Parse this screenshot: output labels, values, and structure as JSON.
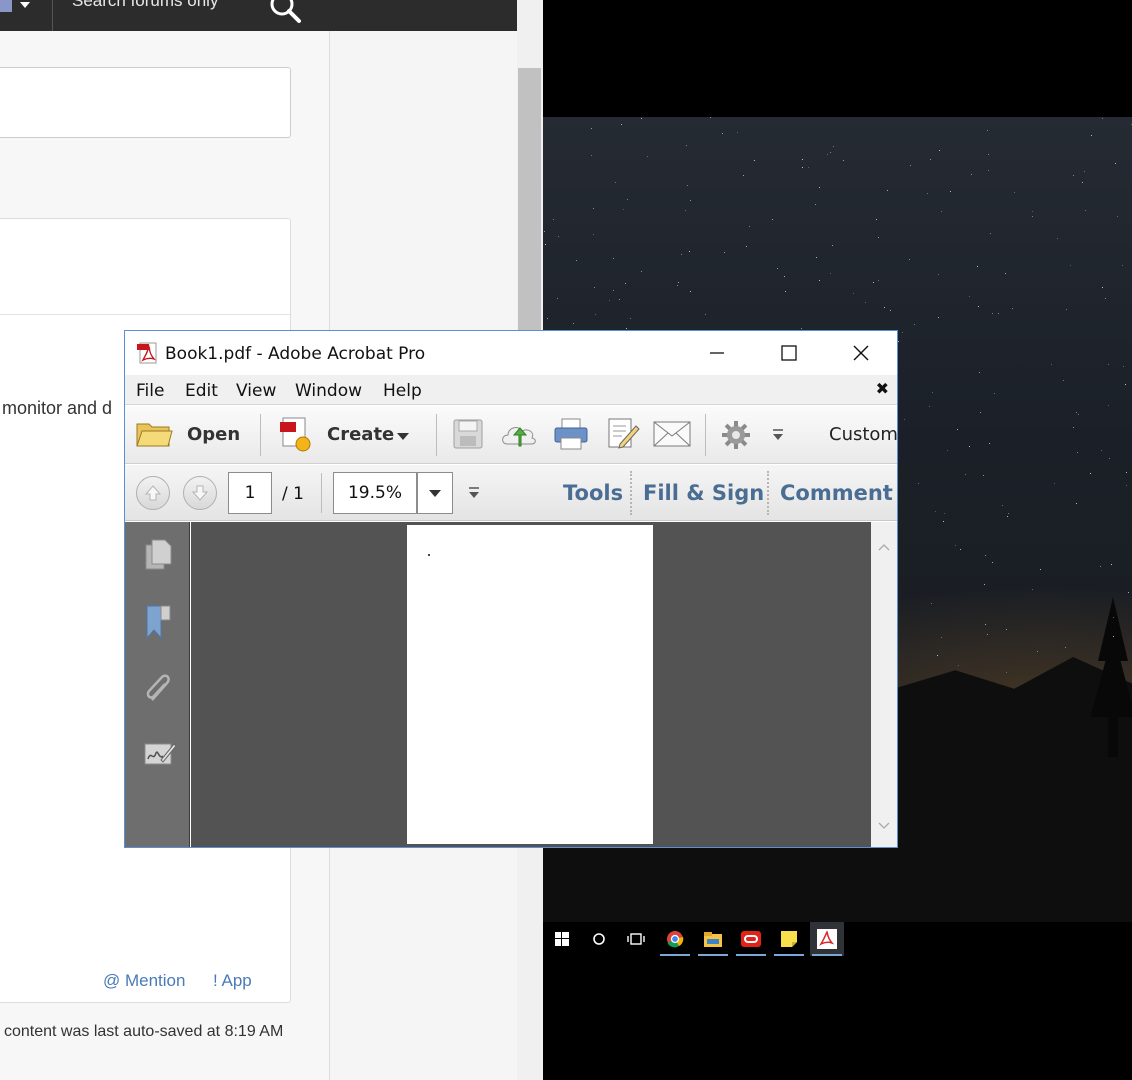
{
  "browser": {
    "search_placeholder": "Search forums only",
    "body_fragment": "monitor and d",
    "mention_label": "@ Mention",
    "app_label": "! App",
    "autosave_text": "content was last auto-saved at 8:19 AM"
  },
  "acrobat": {
    "title": "Book1.pdf - Adobe Acrobat Pro",
    "menu": [
      "File",
      "Edit",
      "View",
      "Window",
      "Help"
    ],
    "toolbar": {
      "open_label": "Open",
      "create_label": "Create",
      "customize_label": "Custom"
    },
    "nav": {
      "page_number": "1",
      "page_total": "/ 1",
      "zoom": "19.5%"
    },
    "panes": {
      "tools": "Tools",
      "fill_sign": "Fill & Sign",
      "comment": "Comment"
    }
  },
  "taskbar": {
    "icons": [
      "windows-start-icon",
      "cortana-search-icon",
      "task-view-icon",
      "chrome-icon",
      "file-explorer-icon",
      "oracle-icon",
      "sticky-notes-icon",
      "acrobat-icon"
    ]
  },
  "colors": {
    "acrobat_accent": "#4a6d94",
    "window_border": "#5b8ed6",
    "link_blue": "#4a7ab8"
  }
}
